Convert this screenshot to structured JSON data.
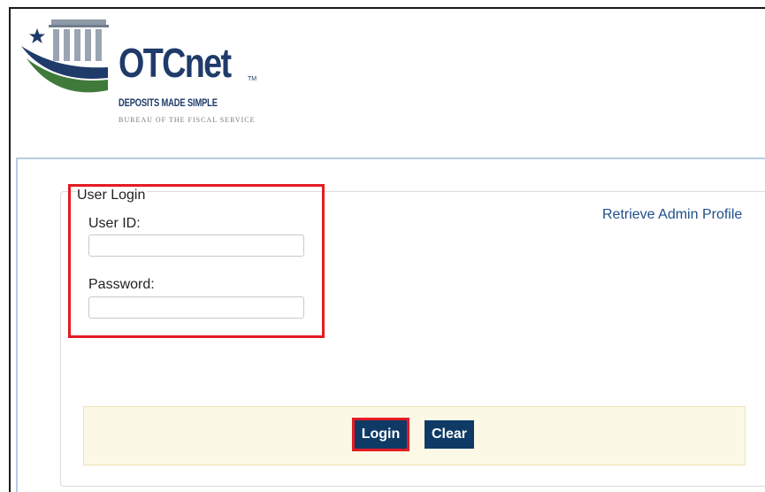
{
  "logo": {
    "wordmark": "OTCnet",
    "trademark": "TM",
    "tagline": "DEPOSITS MADE SIMPLE",
    "bureau": "BUREAU OF THE FISCAL SERVICE"
  },
  "login_form": {
    "legend": "User Login",
    "user_id_label": "User ID:",
    "user_id_value": "",
    "password_label": "Password:",
    "password_value": ""
  },
  "links": {
    "retrieve_admin_profile": "Retrieve Admin Profile"
  },
  "buttons": {
    "login": "Login",
    "clear": "Clear"
  },
  "colors": {
    "brand_navy": "#1f3b6a",
    "brand_green": "#3f7a3a",
    "button_bg": "#0f3a66",
    "highlight_red": "#e41b23",
    "button_bar_bg": "#fbf8e6",
    "link": "#1f4f8b"
  }
}
